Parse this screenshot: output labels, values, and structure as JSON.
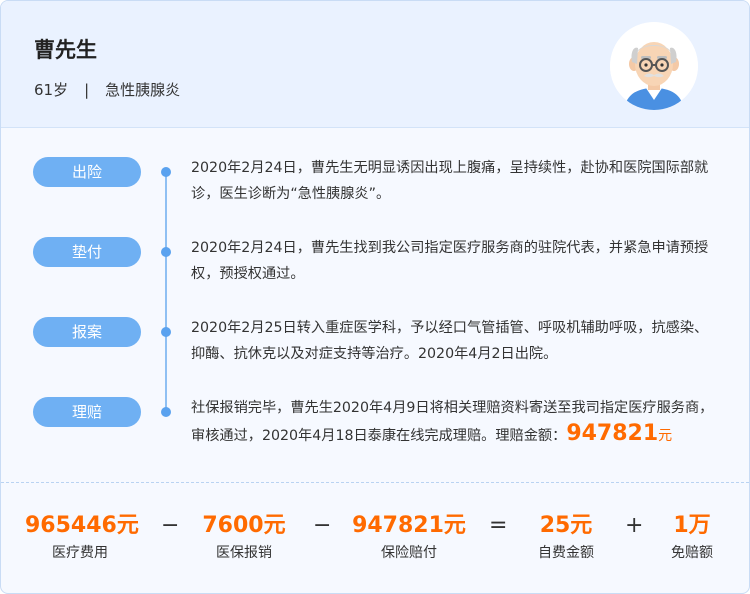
{
  "patient": {
    "name": "曹先生",
    "age": "61岁",
    "separator": "|",
    "diagnosis": "急性胰腺炎"
  },
  "timeline": [
    {
      "stage": "出险",
      "text": "2020年2月24日，曹先生无明显诱因出现上腹痛，呈持续性，赴协和医院国际部就诊，医生诊断为“急性胰腺炎”。"
    },
    {
      "stage": "垫付",
      "text": "2020年2月24日，曹先生找到我公司指定医疗服务商的驻院代表，并紧急申请预授权，预授权通过。"
    },
    {
      "stage": "报案",
      "text": "2020年2月25日转入重症医学科，予以经口气管插管、呼吸机辅助呼吸，抗感染、抑酶、抗休克以及对症支持等治疗。2020年4月2日出院。"
    },
    {
      "stage": "理赔",
      "text": "社保报销完毕，曹先生2020年4月9日将相关理赔资料寄送至我司指定医疗服务商，审核通过，2020年4月18日泰康在线完成理赔。理赔金额：",
      "amount": "947821",
      "unit": "元"
    }
  ],
  "summary": {
    "items": [
      {
        "value": "965446元",
        "label": "医疗费用"
      },
      {
        "value": "7600元",
        "label": "医保报销"
      },
      {
        "value": "947821元",
        "label": "保险赔付"
      },
      {
        "value": "25元",
        "label": "自费金额"
      },
      {
        "value": "1万",
        "label": "免赔额"
      }
    ],
    "operators": [
      "−",
      "−",
      "=",
      "+"
    ]
  },
  "colors": {
    "accent": "#ff6a00",
    "pill": "#6fb0f3",
    "header_bg": "#eaf2ff"
  },
  "icons": {
    "avatar": "elderly-man-avatar-icon"
  }
}
